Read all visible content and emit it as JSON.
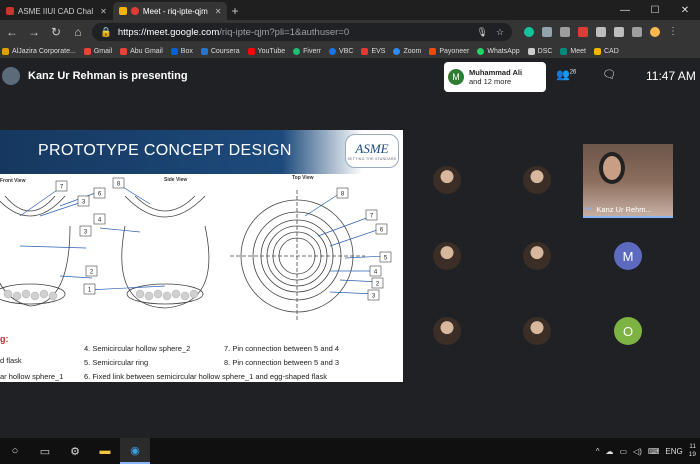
{
  "browser": {
    "tabs": [
      {
        "title": "ASME IIUI CAD Chal",
        "active": false,
        "color": "#c0392b"
      },
      {
        "title": "Meet - riq-ipte-qjm",
        "active": true,
        "color": "#f4b400"
      }
    ],
    "new_tab": "+",
    "url_host": "https://meet.google.com",
    "url_path": "/riq-ipte-qjm?pli=1&authuser=0",
    "bookmarks": [
      {
        "label": "AlJazira Corporate...",
        "color": "#e0a000"
      },
      {
        "label": "Gmail",
        "color": "#ea4335"
      },
      {
        "label": "Abu Gmail",
        "color": "#ea4335"
      },
      {
        "label": "Box",
        "color": "#0061d5"
      },
      {
        "label": "Coursera",
        "color": "#2a73cc"
      },
      {
        "label": "YouTube",
        "color": "#ff0000"
      },
      {
        "label": "Fiverr",
        "color": "#1dbf73"
      },
      {
        "label": "VBC",
        "color": "#1a73e8"
      },
      {
        "label": "EVS",
        "color": "#e53935"
      },
      {
        "label": "Zoom",
        "color": "#2d8cff"
      },
      {
        "label": "Payoneer",
        "color": "#ff4800"
      },
      {
        "label": "WhatsApp",
        "color": "#25d366"
      },
      {
        "label": "DSC",
        "color": "#cccccc"
      },
      {
        "label": "Meet",
        "color": "#00897b"
      },
      {
        "label": "CAD",
        "color": "#f4b400"
      }
    ]
  },
  "meet": {
    "presenter_text": "Kanz Ur Rehman is presenting",
    "chat_popup": {
      "avatar_letter": "M",
      "name": "Muhammad Ali",
      "more": "and 12 more"
    },
    "participants_count": "26",
    "clock": "11:47 AM",
    "self_tile_name": "Kanz Ur Rehm...",
    "letter_tiles": [
      {
        "letter": "M",
        "color": "#5c6bc0"
      },
      {
        "letter": "O",
        "color": "#7cb342"
      }
    ]
  },
  "slide": {
    "title": "PROTOTYPE CONCEPT DESIGN",
    "logo_text": "ASME",
    "logo_tagline": "SETTING THE STANDARD",
    "views": [
      "Front View",
      "Side View",
      "Top View"
    ],
    "legend_heading": "g:",
    "items": [
      "d flask",
      "ar hollow sphere_1",
      "4.  Semicircular hollow sphere_2",
      "5.  Semicircular ring",
      "6.  Fixed link between semicircular hollow sphere_1 and egg-shaped flask",
      "7.  Pin connection between 5 and 4",
      "8.  Pin connection between 5 and 3"
    ],
    "callouts": [
      "7",
      "8",
      "6",
      "3",
      "4",
      "2",
      "1",
      "8",
      "7",
      "6",
      "5",
      "4",
      "3"
    ]
  },
  "taskbar": {
    "lang": "ENG",
    "time_line1": "11",
    "time_line2": "19"
  }
}
